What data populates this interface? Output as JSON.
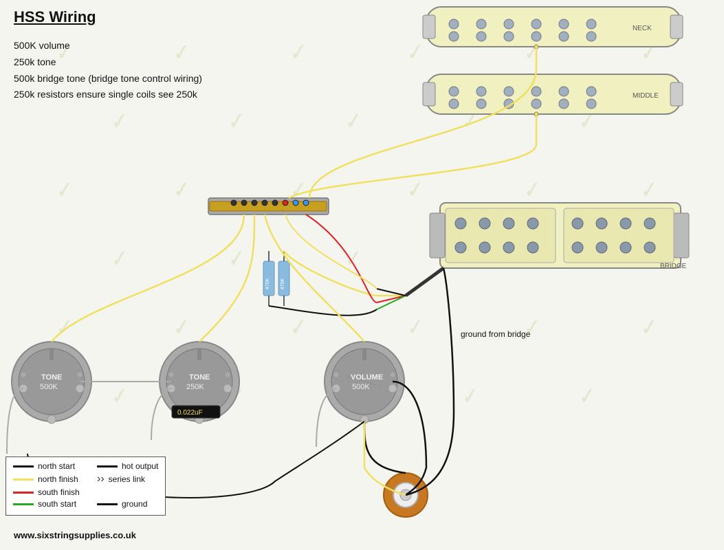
{
  "title": "HSS Wiring",
  "specs": [
    "500K volume",
    "250k tone",
    "500k bridge tone (bridge tone control wiring)",
    "250k resistors ensure single coils see 250k"
  ],
  "website": "www.sixstringsupplies.co.uk",
  "legend": {
    "items": [
      {
        "color": "#111111",
        "label": "north start",
        "right_color": "#111111",
        "right_label": "hot output"
      },
      {
        "color": "#f0e060",
        "label": "north finish",
        "right_symbol": "series_link",
        "right_label": "series link"
      },
      {
        "color": "#dd2222",
        "label": "south finish"
      },
      {
        "color": "#22aa22",
        "label": "south start",
        "right_color": "#111111",
        "right_label": "ground"
      }
    ]
  },
  "pickups": {
    "neck": {
      "label": "NECK",
      "color": "#f0f0c0"
    },
    "middle": {
      "label": "MIDDLE",
      "color": "#f0f0c0"
    },
    "bridge": {
      "label": "BRIDGE",
      "color": "#f0f0c0"
    }
  },
  "pots": {
    "tone1": {
      "label": "TONE",
      "value": "500K"
    },
    "tone2": {
      "label": "TONE",
      "value": "250K"
    },
    "volume": {
      "label": "VOLUME",
      "value": "500K"
    },
    "cap": {
      "label": "0.022uF"
    }
  },
  "resistors": {
    "r1": {
      "label": "470K"
    },
    "r2": {
      "label": "470K"
    }
  },
  "misc": {
    "ground_from_bridge": "ground from bridge"
  },
  "colors": {
    "background": "#f5f5f0",
    "wire_black": "#111111",
    "wire_yellow": "#f0e060",
    "wire_red": "#dd2222",
    "wire_green": "#22aa22",
    "pickup_body": "#f0f0c0",
    "pot_body": "#aaaaaa",
    "selector_body": "#aaaaaa"
  }
}
